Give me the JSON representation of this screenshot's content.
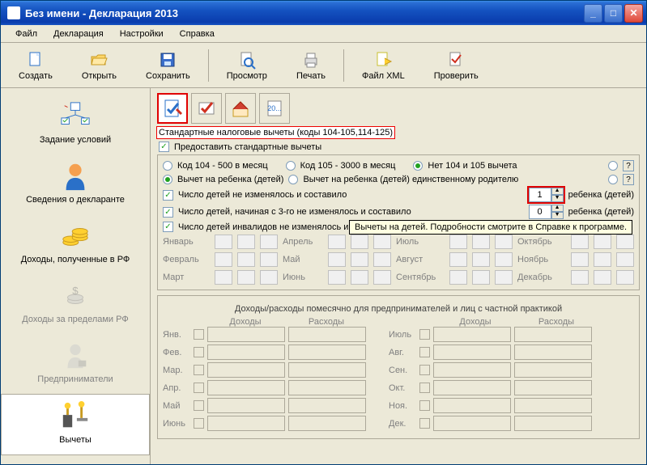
{
  "window": {
    "title": "Без имени - Декларация 2013"
  },
  "menu": [
    "Файл",
    "Декларация",
    "Настройки",
    "Справка"
  ],
  "toolbar": {
    "create": "Создать",
    "open": "Открыть",
    "save": "Сохранить",
    "preview": "Просмотр",
    "print": "Печать",
    "filexml": "Файл XML",
    "check": "Проверить"
  },
  "sidebar": {
    "items": [
      {
        "label": "Задание условий"
      },
      {
        "label": "Сведения о декларанте"
      },
      {
        "label": "Доходы, полученные в РФ"
      },
      {
        "label": "Доходы за пределами РФ",
        "disabled": true
      },
      {
        "label": "Предприниматели",
        "disabled": true
      },
      {
        "label": "Вычеты",
        "selected": true
      }
    ]
  },
  "content": {
    "title": "Стандартные налоговые вычеты (коды 104-105,114-125)",
    "provide_label": "Предоставить стандартные вычеты",
    "code104": "Код 104 - 500 в месяц",
    "code105": "Код 105 - 3000 в месяц",
    "noboth": "Нет 104 и 105 вычета",
    "vychet_child": "Вычет на ребенка (детей)",
    "vychet_child_single": "Вычет на ребенка (детей) единственному родителю",
    "children_no_change": "Число детей не изменялось и составило",
    "children_from3": "Число детей, начиная с 3-го не изменялось и составило",
    "children_invalid": "Число детей инвалидов не изменялось и оставило",
    "rebenka": "ребенка (детей)",
    "spin1": "1",
    "spin2": "0",
    "tooltip": "Вычеты на детей. Подробности смотрите в Справке к программе.",
    "months": [
      "Январь",
      "Февраль",
      "Март",
      "Апрель",
      "Май",
      "Июнь",
      "Июль",
      "Август",
      "Сентябрь",
      "Октябрь",
      "Ноябрь",
      "Декабрь"
    ],
    "entrep_header": "Доходы/расходы помесячно для предпринимателей и лиц с частной практикой",
    "col_income": "Доходы",
    "col_expense": "Расходы",
    "monthshort": [
      "Янв.",
      "Фев.",
      "Мар.",
      "Апр.",
      "Май",
      "Июнь",
      "Июль",
      "Авг.",
      "Сен.",
      "Окт.",
      "Ноя.",
      "Дек."
    ],
    "q": "?"
  }
}
